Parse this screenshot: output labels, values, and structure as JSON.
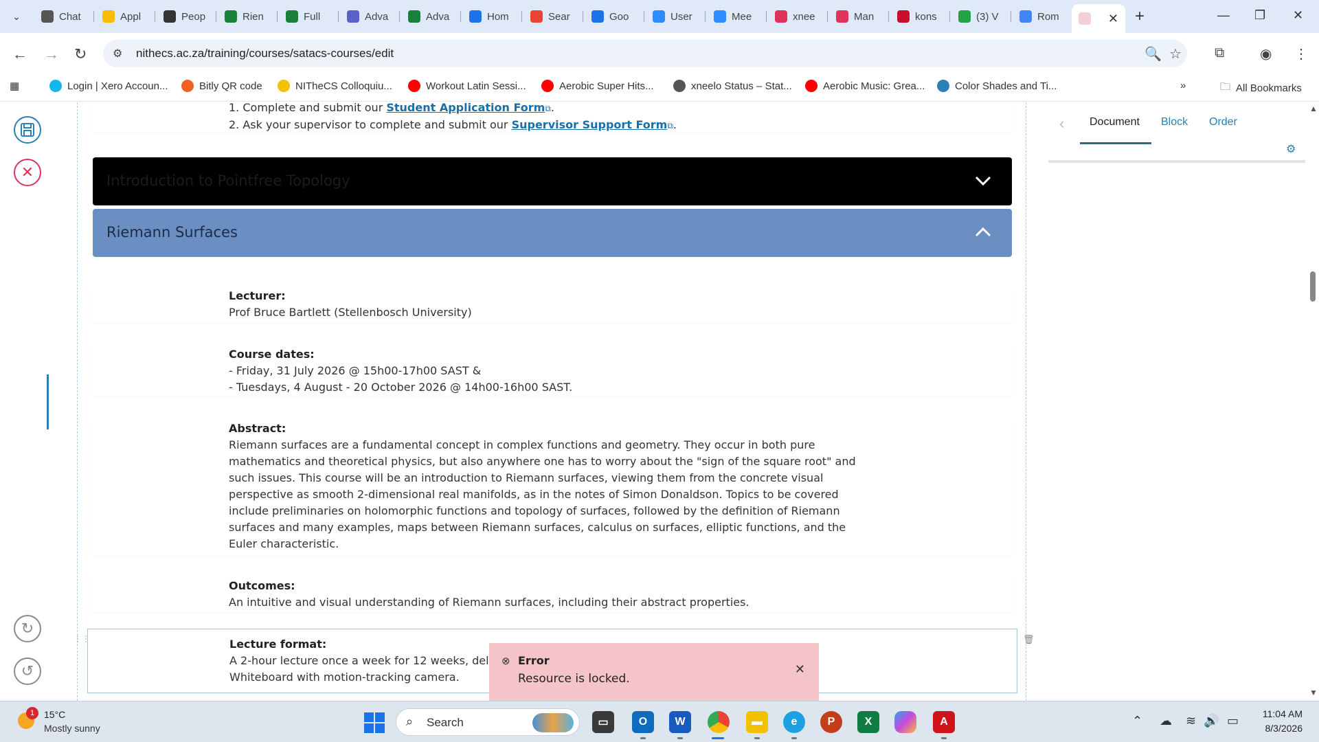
{
  "browser": {
    "tabs": [
      {
        "label": "Chat",
        "color": "#555555",
        "icon": "openai-icon"
      },
      {
        "label": "Appl",
        "color": "#fbbc04",
        "icon": "drive-icon"
      },
      {
        "label": "Peop",
        "color": "#333333",
        "icon": "contacts-icon"
      },
      {
        "label": "Rien",
        "color": "#188038",
        "icon": "sheets-icon"
      },
      {
        "label": "Full",
        "color": "#188038",
        "icon": "sheets-icon"
      },
      {
        "label": "Adva",
        "color": "#5b5fc7",
        "icon": "teams-icon"
      },
      {
        "label": "Adva",
        "color": "#188038",
        "icon": "sheets-icon"
      },
      {
        "label": "Hom",
        "color": "#1a73e8",
        "icon": "canva-icon"
      },
      {
        "label": "Sear",
        "color": "#ea4335",
        "icon": "gmail-icon"
      },
      {
        "label": "Goo",
        "color": "#1a73e8",
        "icon": "docs-icon"
      },
      {
        "label": "User",
        "color": "#2d8cff",
        "icon": "zoom-icon"
      },
      {
        "label": "Mee",
        "color": "#2d8cff",
        "icon": "zoom-icon"
      },
      {
        "label": "xnee",
        "color": "#e0335a",
        "icon": "xneelo-icon"
      },
      {
        "label": "Man",
        "color": "#e0335a",
        "icon": "xneelo-icon"
      },
      {
        "label": "kons",
        "color": "#c8102e",
        "icon": "konsole-icon"
      },
      {
        "label": "(3) V",
        "color": "#25a244",
        "icon": "whatsapp-icon"
      },
      {
        "label": "Rom",
        "color": "#4285f4",
        "icon": "google-icon"
      }
    ],
    "active_tab_label": "",
    "url": "nithecs.ac.za/training/courses/satacs-courses/edit",
    "bookmarks": [
      {
        "label": "Login | Xero Accoun...",
        "color": "#13b5ea"
      },
      {
        "label": "Bitly QR code",
        "color": "#ee6123"
      },
      {
        "label": "NITheCS Colloquiu...",
        "color": "#f2c200"
      },
      {
        "label": "Workout Latin Sessi...",
        "color": "#ff0000"
      },
      {
        "label": "Aerobic Super Hits...",
        "color": "#ff0000"
      },
      {
        "label": "xneelo Status – Stat...",
        "color": "#555555"
      },
      {
        "label": "Aerobic Music: Grea...",
        "color": "#ff0000"
      },
      {
        "label": "Color Shades and Ti...",
        "color": "#2a7fb5"
      }
    ],
    "all_bookmarks": "All Bookmarks"
  },
  "page": {
    "intro_line1_prefix": "1. Complete and submit our ",
    "intro_line1_link": "Student Application Form",
    "intro_line2_prefix": "2. Ask your supervisor to complete and submit our ",
    "intro_line2_link": "Supervisor Support Form",
    "accordion_collapsed_title": "Introduction to Pointfree Topology",
    "accordion_expanded_title": "Riemann Surfaces",
    "accordion_expanded_color": "#6b8fc3",
    "lecturer_label": "Lecturer:",
    "lecturer_value": "Prof Bruce Bartlett (Stellenbosch University)",
    "dates_label": "Course dates:",
    "dates_line1": "- Friday, 31 July 2026 @ 15h00-17h00 SAST &",
    "dates_line2": "- Tuesdays, 4 August - 20 October 2026 @ 14h00-16h00 SAST.",
    "abstract_label": "Abstract:",
    "abstract_lines": [
      "Riemann surfaces are a fundamental concept in complex functions and geometry. They occur in both pure",
      "mathematics and theoretical physics, but also anywhere one has to worry about the \"sign of the square root\" and",
      "such issues. This course will be an introduction to Riemann surfaces, viewing them from the concrete visual",
      "perspective as smooth 2-dimensional real manifolds, as in the notes of Simon Donaldson. Topics to be covered",
      "include preliminaries on holomorphic functions and topology of surfaces, followed by the definition of Riemann",
      "surfaces and many examples, maps between Riemann surfaces, calculus on surfaces, elliptic functions, and the",
      "Euler characteristic."
    ],
    "outcomes_label": "Outcomes:",
    "outcomes_value": "An intuitive and visual understanding of Riemann surfaces, including their abstract properties.",
    "format_label": "Lecture format:",
    "format_line1": "A 2-hour lecture once a week for 12 weeks, deliv",
    "format_line2": "Whiteboard with motion-tracking camera."
  },
  "toast": {
    "title": "Error",
    "message": "Resource is locked."
  },
  "sidebar": {
    "tabs": [
      "Document",
      "Block",
      "Order"
    ],
    "active_tab": "Document"
  },
  "taskbar": {
    "weather_badge": "1",
    "temperature": "15°C",
    "condition": "Mostly sunny",
    "search_placeholder": "Search",
    "time": "11:04 AM",
    "date": "8/3/2026"
  }
}
